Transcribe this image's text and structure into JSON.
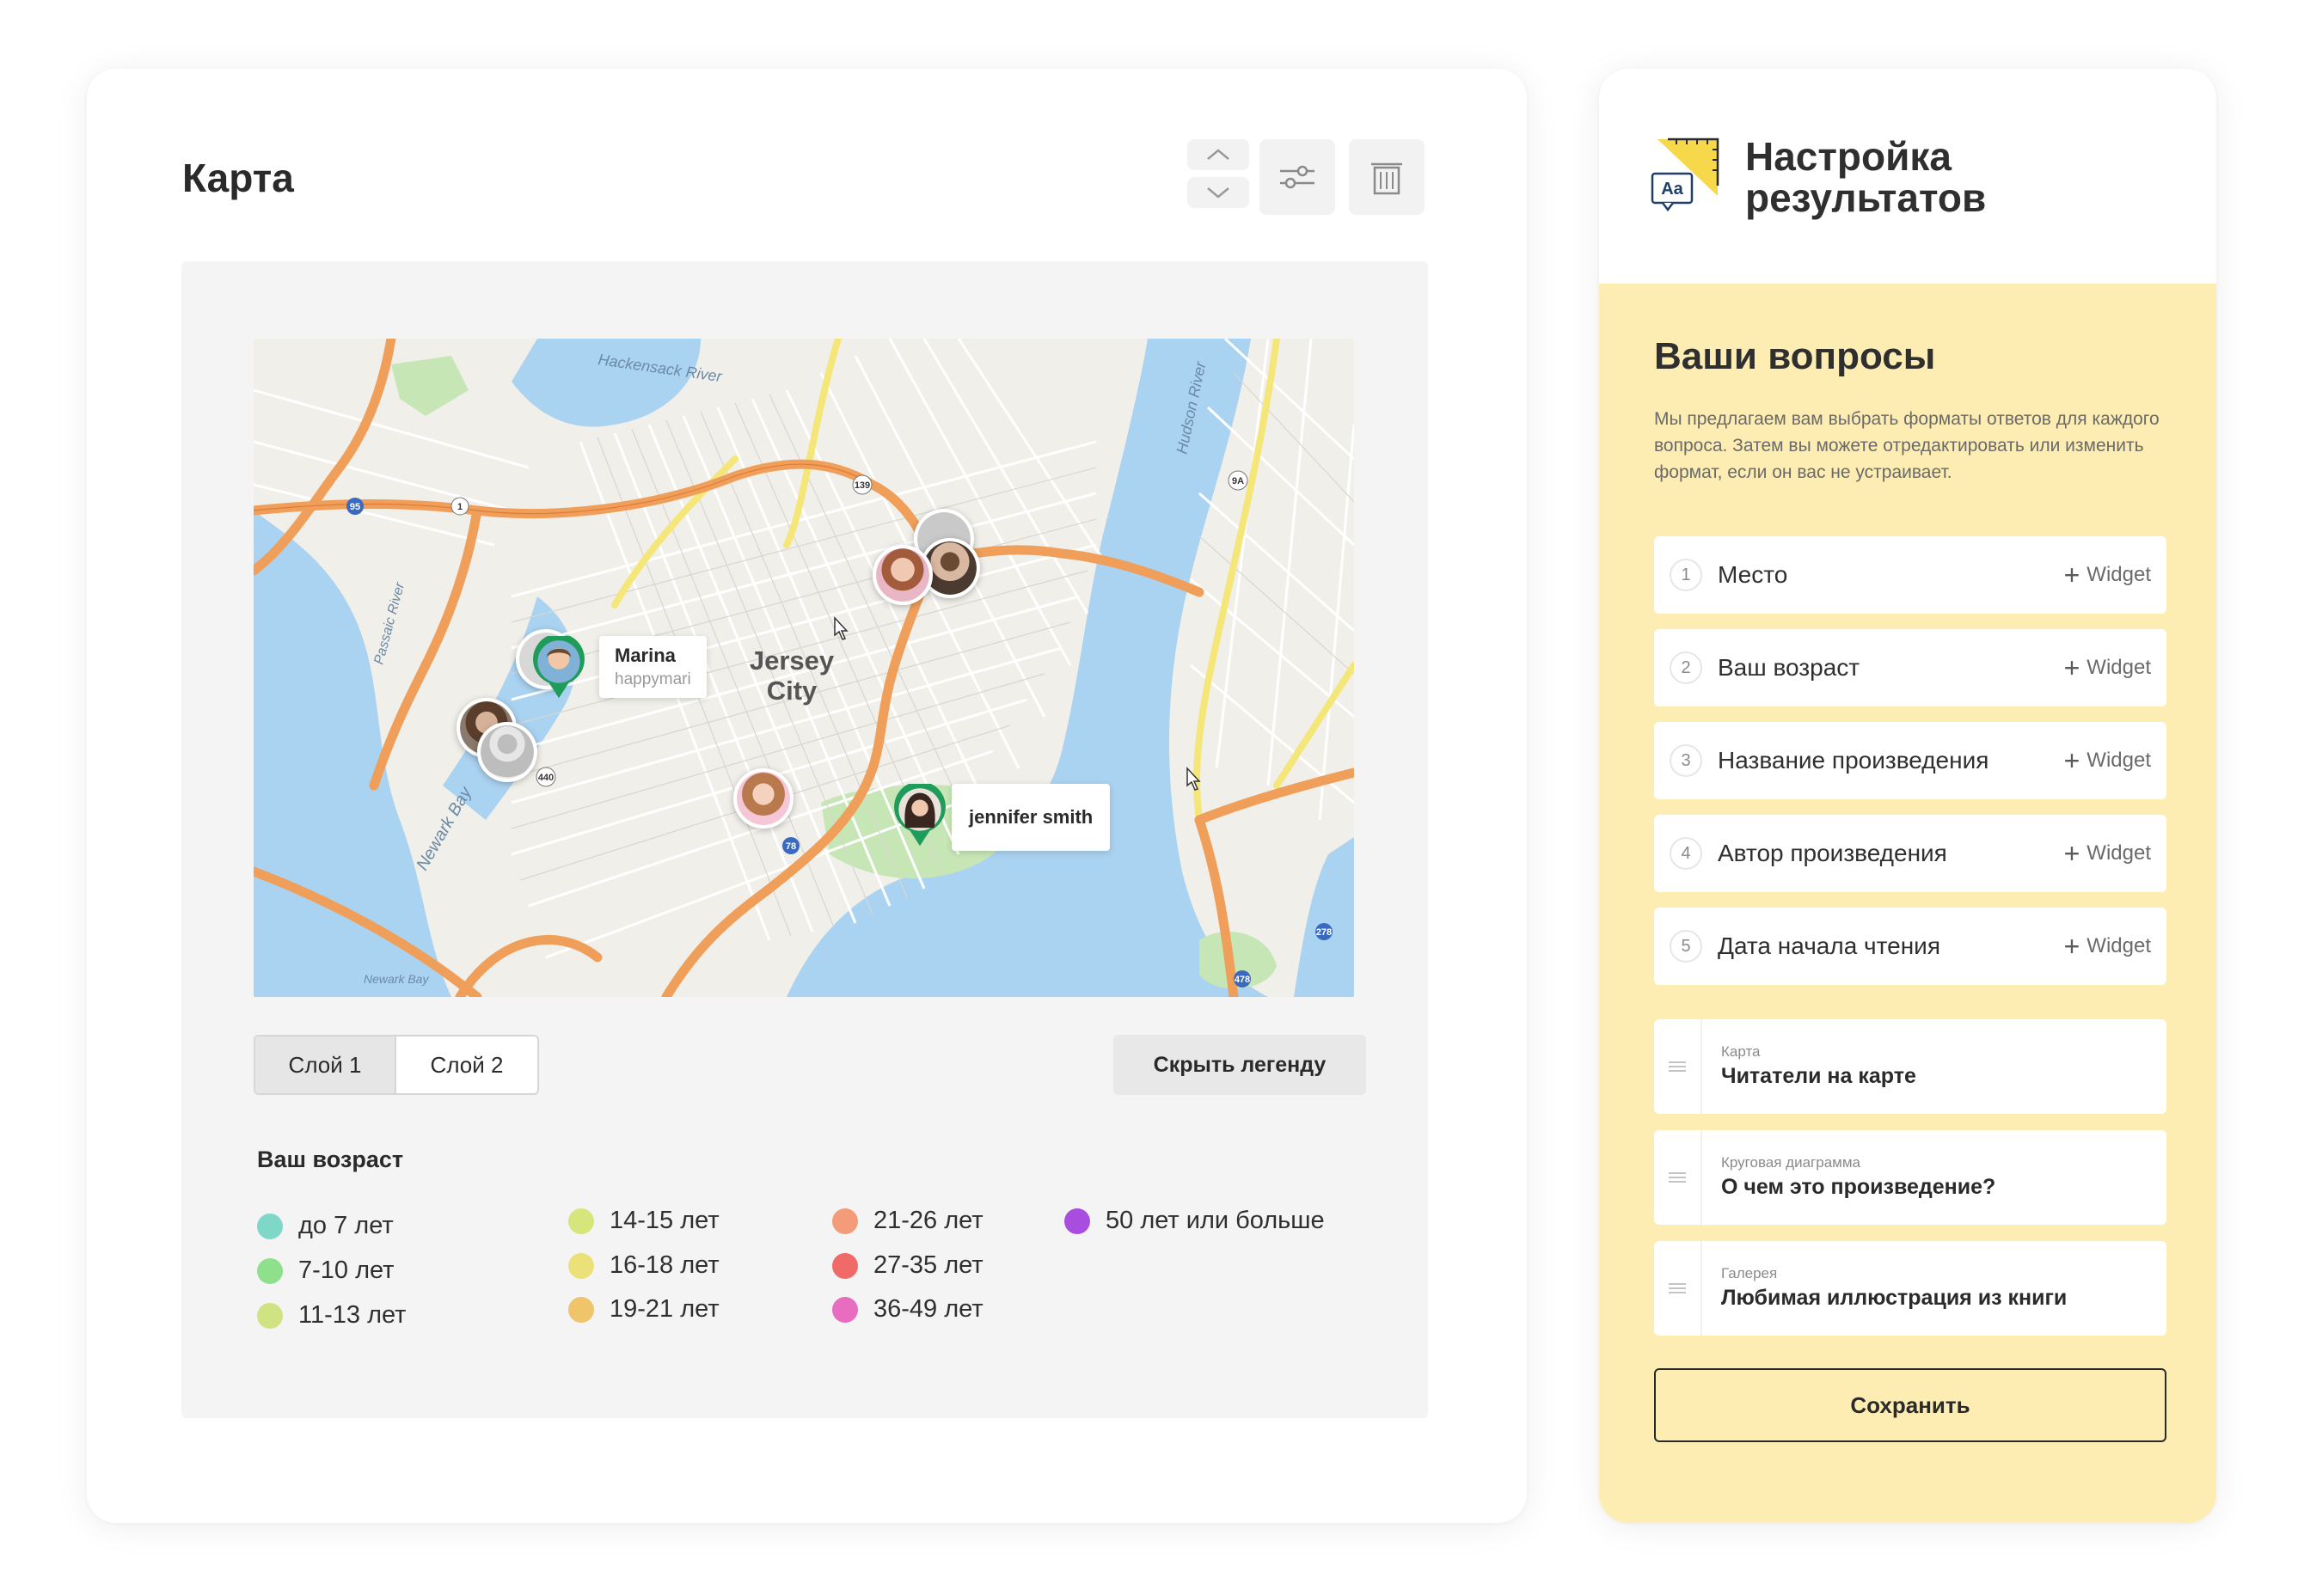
{
  "map_card": {
    "title": "Карта",
    "toolbar": {
      "up_icon": "chevron-up-icon",
      "down_icon": "chevron-down-icon",
      "settings_icon": "sliders-icon",
      "delete_icon": "trash-icon"
    },
    "map": {
      "labels": {
        "city": [
          "Jersey",
          "City"
        ],
        "rivers": [
          "Hackensack River",
          "Hudson River",
          "Passaic River",
          "Newark Bay"
        ],
        "bay_small": "Newark Bay",
        "routes": [
          "95",
          "1",
          "139",
          "9A",
          "440",
          "78",
          "278",
          "478"
        ]
      },
      "pins": [
        {
          "name": "Marina",
          "handle": "happymari"
        },
        {
          "name": "jennifer smith",
          "handle": ""
        }
      ]
    },
    "layers": {
      "layer1": "Слой 1",
      "layer2": "Слой 2"
    },
    "hide_legend": "Скрыть легенду",
    "legend": {
      "title": "Ваш возраст",
      "items": [
        {
          "label": "до 7 лет",
          "color": "#7fd8c7"
        },
        {
          "label": "7-10 лет",
          "color": "#8fe08c"
        },
        {
          "label": "11-13 лет",
          "color": "#cfe383"
        },
        {
          "label": "14-15 лет",
          "color": "#d6e67b"
        },
        {
          "label": "16-18 лет",
          "color": "#ece178"
        },
        {
          "label": "19-21 лет",
          "color": "#f0c46a"
        },
        {
          "label": "21-26 лет",
          "color": "#f49c79"
        },
        {
          "label": "27-35 лет",
          "color": "#f06a6a"
        },
        {
          "label": "36-49 лет",
          "color": "#e86cc0"
        },
        {
          "label": "50 лет или больше",
          "color": "#a94de0"
        }
      ]
    }
  },
  "results_panel": {
    "logo_text": "Aa",
    "title_line1": "Настройка",
    "title_line2": "результатов",
    "section_title": "Ваши вопросы",
    "description": "Мы предлагаем вам выбрать форматы ответов для каждого вопроса. Затем вы можете отредактировать или изменить формат, если он вас не устраивает.",
    "questions": [
      {
        "num": "1",
        "label": "Место",
        "action": "Widget"
      },
      {
        "num": "2",
        "label": "Ваш возраст",
        "action": "Widget"
      },
      {
        "num": "3",
        "label": "Название произведения",
        "action": "Widget"
      },
      {
        "num": "4",
        "label": "Автор произведения",
        "action": "Widget"
      },
      {
        "num": "5",
        "label": "Дата начала чтения",
        "action": "Widget"
      }
    ],
    "widgets": [
      {
        "type": "Карта",
        "title": "Читатели на карте"
      },
      {
        "type": "Круговая диаграмма",
        "title": "О чем это произведение?"
      },
      {
        "type": "Галерея",
        "title": "Любимая иллюстрация из книги"
      }
    ],
    "save_label": "Сохранить"
  }
}
